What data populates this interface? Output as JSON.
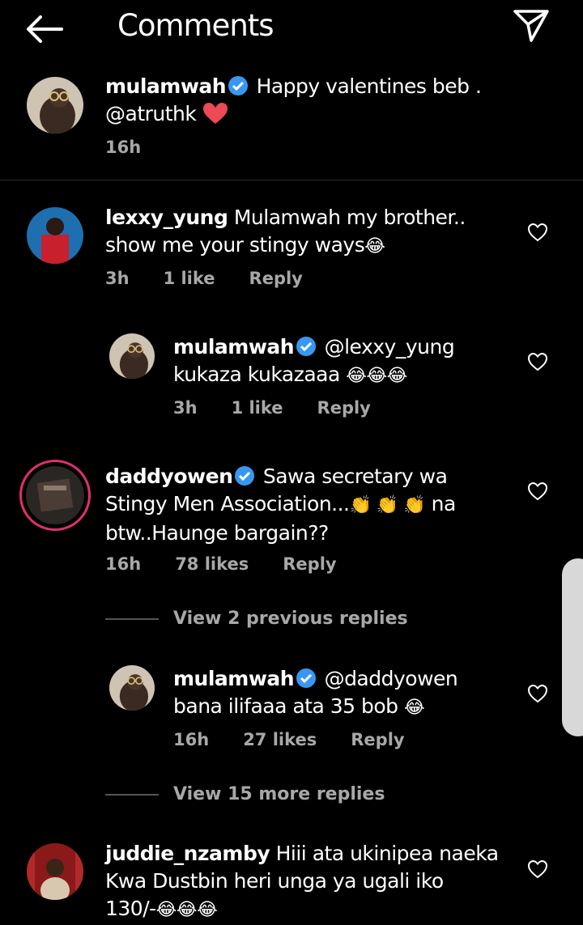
{
  "header": {
    "title": "Comments"
  },
  "caption": {
    "username": "mulamwah",
    "text_line1": "Happy valentines beb .",
    "text_line2": "@atruthk",
    "time": "16h"
  },
  "comments": [
    {
      "username": "lexxy_yung",
      "line1": "Mulamwah my brother..",
      "line2": "show me your stingy ways",
      "line2_emoji": "😂",
      "time": "3h",
      "likes": "1 like",
      "reply": "Reply"
    },
    {
      "username": "mulamwah",
      "line1": "@lexxy_yung",
      "line2": "kukaza kukazaaa",
      "line2_emoji": "😂😂😂",
      "time": "3h",
      "likes": "1 like",
      "reply": "Reply"
    },
    {
      "username": "daddyowen",
      "line1": "Sawa secretary wa",
      "line2a": "Stingy Men Association...",
      "line2_emoji": "👏 👏 👏",
      "line2b": "na",
      "line3": "btw..Haunge bargain??",
      "time": "16h",
      "likes": "78 likes",
      "reply": "Reply"
    },
    {
      "username": "mulamwah",
      "line1": "@daddyowen",
      "line2": "bana ilifaaa ata 35 bob",
      "line2_emoji": "😂",
      "time": "16h",
      "likes": "27 likes",
      "reply": "Reply"
    },
    {
      "username": "juddie_nzamby",
      "line1": "Hiii ata ukinipea naeka",
      "line2": "Kwa Dustbin heri unga ya ugali iko",
      "line3": "130/-",
      "line3_emoji": "😂😂😂"
    }
  ],
  "view_replies": [
    "View 2 previous replies",
    "View 15 more replies"
  ],
  "colors": {
    "verified": "#3897f0",
    "heart_red": "#ed4956",
    "story_ring": "#e1306c"
  }
}
